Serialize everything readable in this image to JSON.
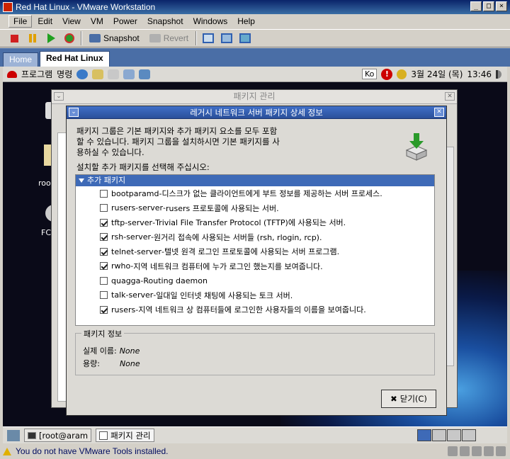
{
  "vmware": {
    "title": "Red Hat Linux - VMware Workstation",
    "menu": [
      "File",
      "Edit",
      "View",
      "VM",
      "Power",
      "Snapshot",
      "Windows",
      "Help"
    ],
    "toolbar": {
      "snapshot_label": "Snapshot",
      "revert_label": "Revert"
    },
    "tabs": [
      "Home",
      "Red Hat Linux"
    ],
    "status_text": "You do not have VMware Tools installed."
  },
  "guest_panel": {
    "menu_programs": "프로그램",
    "menu_commands": "명령",
    "input_method": "Ko",
    "date": "3월 24일 (목)",
    "time": "13:46"
  },
  "desktop": {
    "icon1_label": "root",
    "icon2_label": "FC"
  },
  "background_window": {
    "title": "패키지 관리"
  },
  "dialog": {
    "title": "레거시 네트워크 서버 패키지 상세 정보",
    "description": "패키지 그룹은 기본 패키지와 추가 패키지 요소를 모두 포함\n할 수 있습니다. 패키지 그룹을 설치하시면 기본 패키지를 사\n용하실 수 있습니다.",
    "prompt": "설치할 추가 패키지를 선택해 주십시오:",
    "list_header": "추가 패키지",
    "packages": [
      {
        "name": "bootparamd",
        "desc": "디스크가 없는 클라이언트에게 부트 정보를 제공하는 서버 프로세스.",
        "checked": false
      },
      {
        "name": "rusers-server",
        "desc": "rusers 프로토콜에 사용되는 서버.",
        "checked": false
      },
      {
        "name": "tftp-server",
        "desc": "Trivial File Transfer Protocol (TFTP)에 사용되는 서버.",
        "checked": true
      },
      {
        "name": "rsh-server",
        "desc": "원거리 접속에 사용되는 서버들 (rsh, rlogin, rcp).",
        "checked": true
      },
      {
        "name": "telnet-server",
        "desc": "텔넷 원격 로그인 프로토콜에 사용되는 서버 프로그램.",
        "checked": true
      },
      {
        "name": "rwho",
        "desc": "지역 네트워크 컴퓨터에 누가 로그인 했는지를 보여줍니다.",
        "checked": true
      },
      {
        "name": "quagga",
        "desc": "Routing daemon",
        "checked": false
      },
      {
        "name": "talk-server",
        "desc": "일대일 인터넷 채팅에 사용되는 토크 서버.",
        "checked": false
      },
      {
        "name": "rusers",
        "desc": "지역 네트워크 상 컴퓨터들에 로그인한 사용자들의 이름을 보여줍니다.",
        "checked": true
      }
    ],
    "pkg_info": {
      "title": "패키지 정보",
      "actual_name_label": "실제 이름:",
      "actual_name_value": "None",
      "size_label": "용량:",
      "size_value": "None"
    },
    "close_label": "닫기(C)"
  },
  "guest_taskbar": {
    "terminal_label": "[root@aram",
    "pkgmgr_label": "패키지 관리"
  }
}
